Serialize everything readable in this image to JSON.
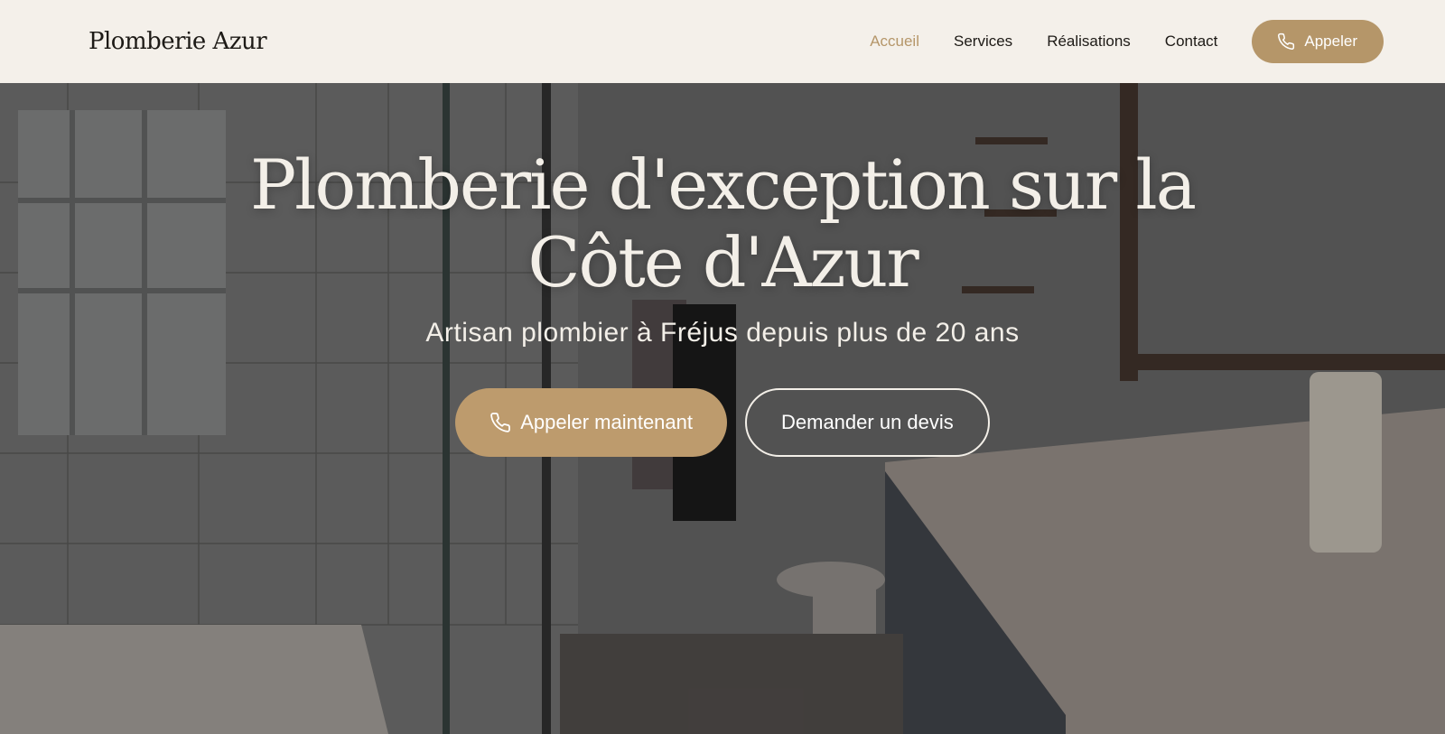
{
  "header": {
    "logo": "Plomberie Azur",
    "nav": [
      {
        "label": "Accueil",
        "active": true
      },
      {
        "label": "Services",
        "active": false
      },
      {
        "label": "Réalisations",
        "active": false
      },
      {
        "label": "Contact",
        "active": false
      }
    ],
    "call_button": {
      "label": "Appeler",
      "icon": "phone-icon"
    }
  },
  "hero": {
    "title_line1": "Plomberie d'exception sur la",
    "title_line2": "Côte d'Azur",
    "subtitle": "Artisan plombier à Fréjus depuis plus de 20 ans",
    "primary_button": {
      "label": "Appeler maintenant",
      "icon": "phone-icon"
    },
    "secondary_button": {
      "label": "Demander un devis"
    },
    "background": "bathroom-photo"
  },
  "colors": {
    "accent": "#b59669",
    "header_bg": "#f4f0ea",
    "text_dark": "#1d1a16",
    "hero_text": "#f3efe8"
  }
}
